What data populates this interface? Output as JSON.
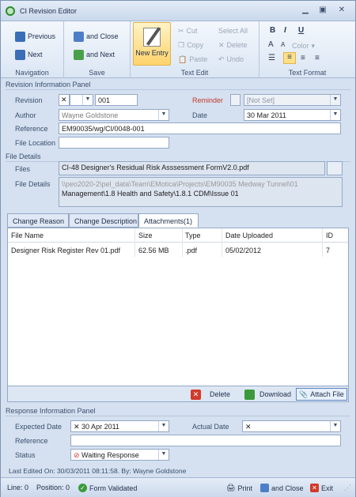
{
  "window": {
    "title": "CI Revision Editor"
  },
  "ribbon": {
    "navigation": {
      "title": "Navigation",
      "previous": "Previous",
      "next": "Next"
    },
    "save": {
      "title": "Save",
      "and_close": "and Close",
      "and_next": "and Next"
    },
    "text_edit": {
      "title": "Text Edit",
      "new_entry": "New Entry",
      "cut": "Cut",
      "copy": "Copy",
      "paste": "Paste",
      "select_all": "Select All",
      "delete": "Delete",
      "undo": "Undo"
    },
    "text_format": {
      "title": "Text Format",
      "bold": "B",
      "italic": "I",
      "underline": "U",
      "color": "Color"
    }
  },
  "revision_panel": {
    "title": "Revision Information Panel",
    "revision_label": "Revision",
    "revision_value": "001",
    "reminder_label": "Reminder",
    "reminder_value": "[Not Set]",
    "author_label": "Author",
    "author_value": "Wayne Goldstone",
    "date_label": "Date",
    "date_value": "30 Mar 2011",
    "reference_label": "Reference",
    "reference_value": "EM90035/wg/CI/0048-001",
    "file_location_label": "File Location",
    "file_location_value": ""
  },
  "file_details": {
    "title": "File Details",
    "files_label": "Files",
    "files_value": "CI-48 Designer's Residual Risk Asssessment FormV2.0.pdf",
    "details_label": "File Details",
    "details_line1": "\\\\peo2020-2\\pel_data\\Team\\EMotica\\Projects\\EM90035 Medway Tunnel\\01",
    "details_line2": "Management\\1.8 Health and Safety\\1.8.1 CDM\\Issue 01"
  },
  "tabs": [
    {
      "label": "Change Reason"
    },
    {
      "label": "Change Description"
    },
    {
      "label": "Attachments(1)"
    }
  ],
  "attachments": {
    "columns": [
      "File Name",
      "Size",
      "Type",
      "Date Uploaded",
      "ID"
    ],
    "rows": [
      {
        "file_name": "Designer Risk Register Rev 01.pdf",
        "size": "62.56 MB",
        "type": ".pdf",
        "date": "05/02/2012",
        "id": "7"
      }
    ],
    "delete": "Delete",
    "download": "Download",
    "attach": "Attach File"
  },
  "response_panel": {
    "title": "Response Information Panel",
    "expected_label": "Expected Date",
    "expected_value": "30 Apr 2011",
    "actual_label": "Actual Date",
    "actual_value": "",
    "reference_label": "Reference",
    "reference_value": "",
    "status_label": "Status",
    "status_value": "Waiting Response"
  },
  "last_edited": "Last Edited On: 30/03/2011 08:11:58. By: Wayne Goldstone",
  "statusbar": {
    "line": "Line: 0",
    "position": "Position: 0",
    "validated": "Form Validated",
    "print": "Print",
    "and_close": "and Close",
    "exit": "Exit"
  },
  "colors": {
    "accent": "#d5e1f0",
    "reminder_label": "#c0392b",
    "highlight": "#ffd36b"
  }
}
